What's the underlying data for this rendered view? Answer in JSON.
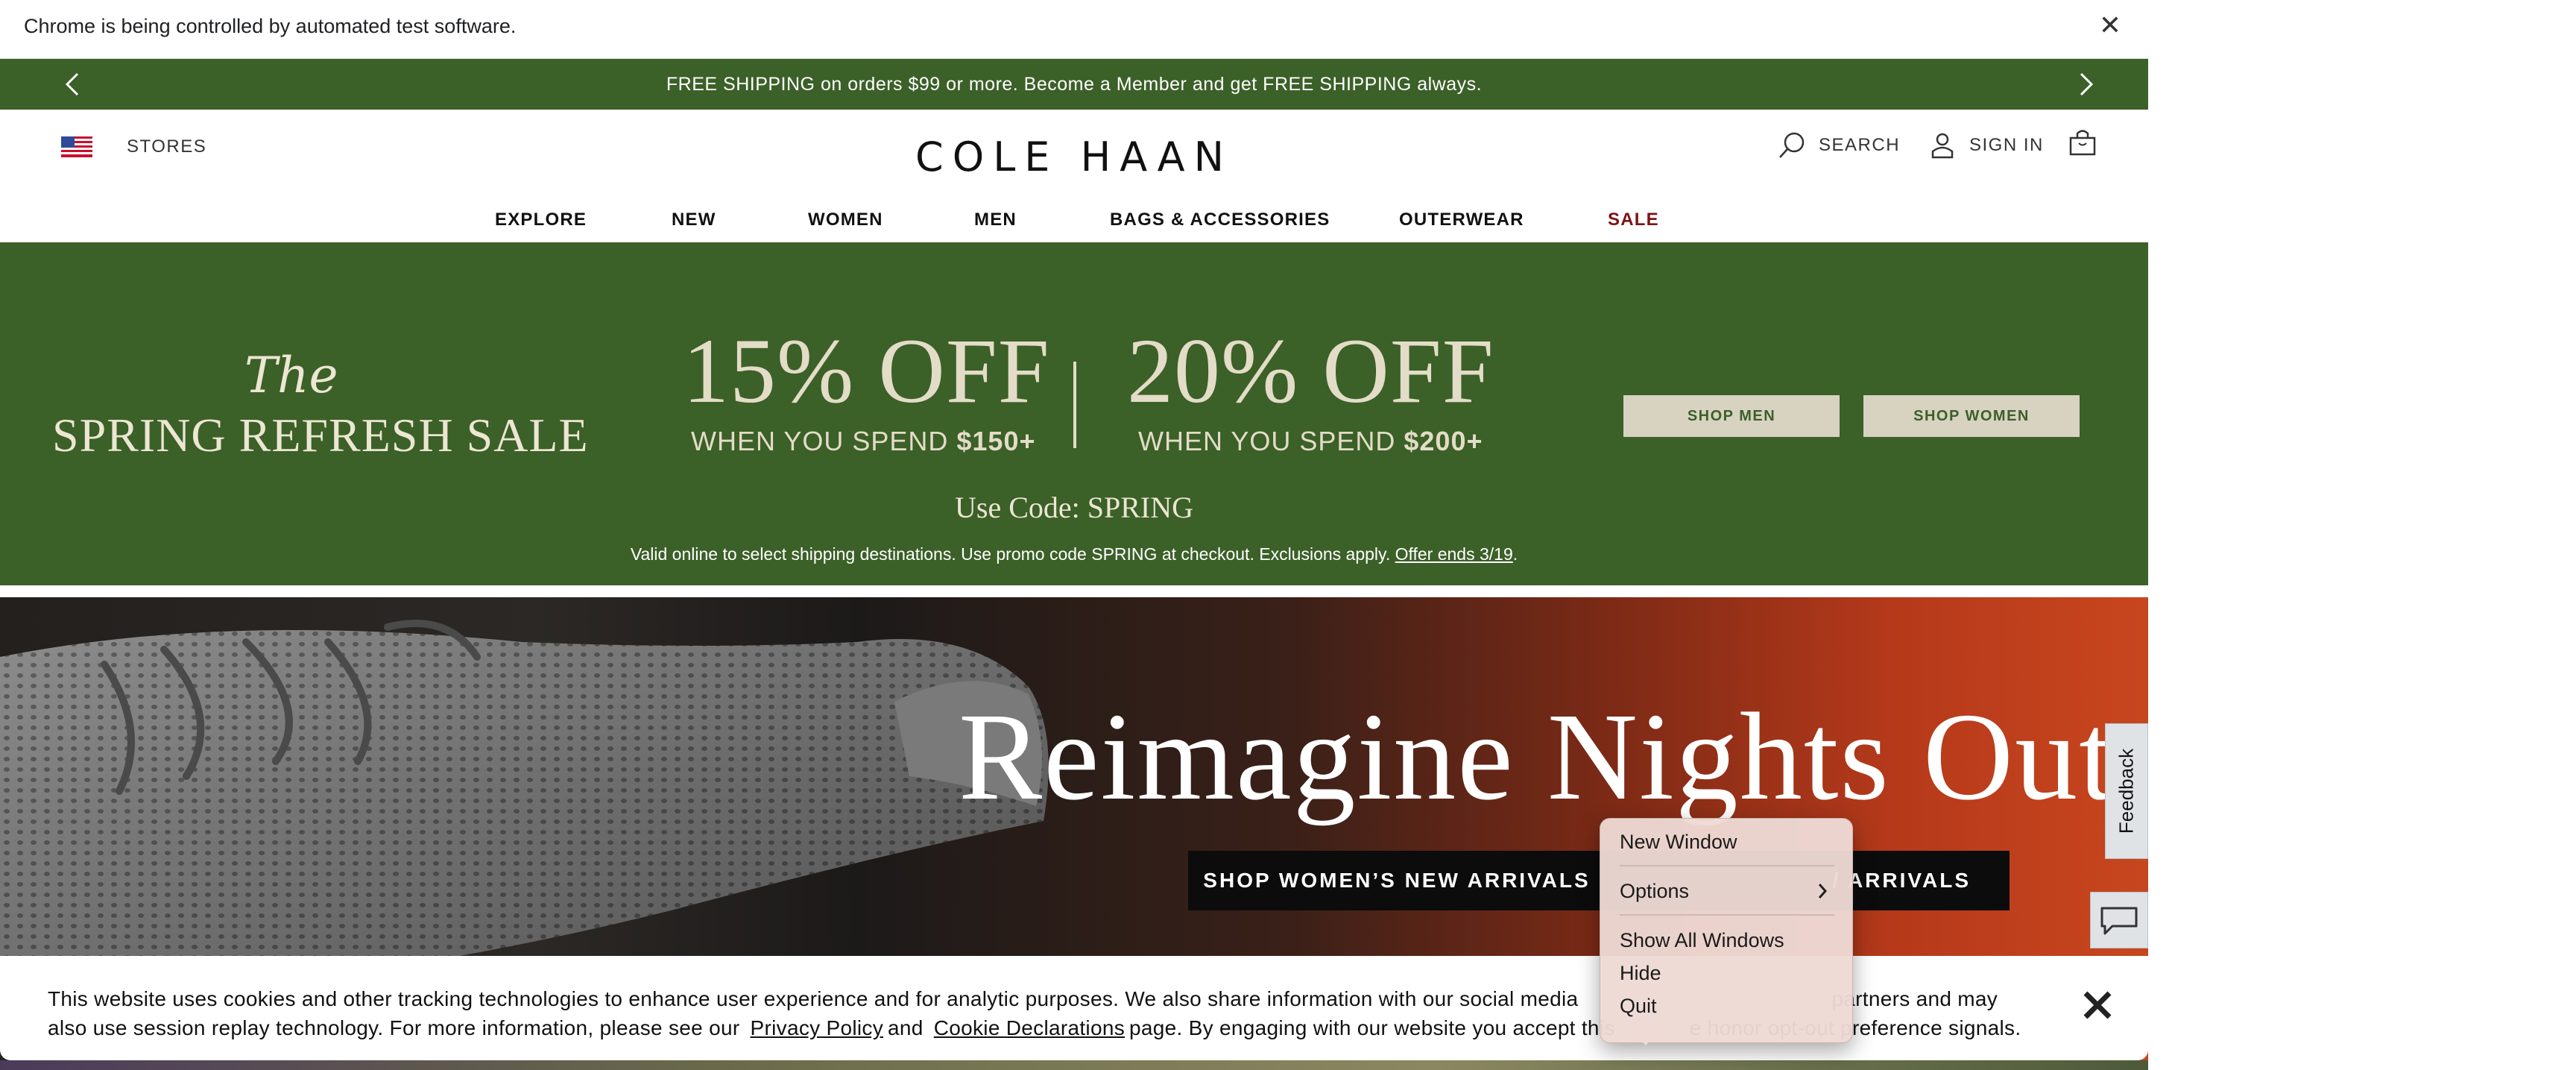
{
  "automation_bar": {
    "message": "Chrome is being controlled by automated test software.",
    "close_glyph": "✕"
  },
  "promo": {
    "text": "FREE SHIPPING on orders $99 or more. Become a Member and get FREE SHIPPING always.",
    "background": "#3b6028"
  },
  "header": {
    "stores_label": "STORES",
    "logo": "COLE HAAN",
    "search_label": "SEARCH",
    "signin_label": "SIGN IN"
  },
  "nav": {
    "items": [
      "EXPLORE",
      "NEW",
      "WOMEN",
      "MEN",
      "BAGS & ACCESSORIES",
      "OUTERWEAR",
      "SALE"
    ]
  },
  "sale_banner": {
    "the": "The",
    "title": "SPRING REFRESH SALE",
    "offer1": {
      "percent": "15% OFF",
      "spend_prefix": "WHEN YOU SPEND ",
      "spend_amount": "$150+"
    },
    "offer2": {
      "percent": "20% OFF",
      "spend_prefix": "WHEN YOU SPEND ",
      "spend_amount": "$200+"
    },
    "code": "Use Code: SPRING",
    "fine_print": "Valid online to select shipping destinations. Use promo code SPRING at checkout. Exclusions apply. ",
    "fine_link": "Offer ends 3/19",
    "fine_end": ".",
    "shop_men": "SHOP MEN",
    "shop_women": "SHOP WOMEN"
  },
  "hero": {
    "title": "Reimagine Nights Out",
    "btn_women": "SHOP WOMEN’S NEW ARRIVALS",
    "btn_men": "/ ARRIVALS"
  },
  "feedback_label": "Feedback",
  "cookie": {
    "text_part1": "This website uses cookies and other tracking technologies to enhance user experience and for analytic purposes. We also share information with our social media",
    "text_hidden": " partners and may also use session replay technology. For more information, please see our ",
    "text_line1_end": "partners and may",
    "text_line2_start": "also use session replay technology. For more information, please see our",
    "privacy_link": "Privacy Policy",
    "and": "and",
    "cookie_link": "Cookie Declarations",
    "text_end": "page. By engaging with our website you accept this",
    "text_tail": "e honor opt-out preference signals."
  },
  "context_menu": {
    "items": [
      "New Window",
      "Options",
      "Show All Windows",
      "Hide",
      "Quit"
    ],
    "background": "#eedad4"
  },
  "icons": [
    "us-flag-icon",
    "search-icon",
    "user-icon",
    "bag-icon",
    "chevron-left-icon",
    "chevron-right-icon",
    "chat-icon",
    "close-icon",
    "chevron-right-menu-icon"
  ]
}
